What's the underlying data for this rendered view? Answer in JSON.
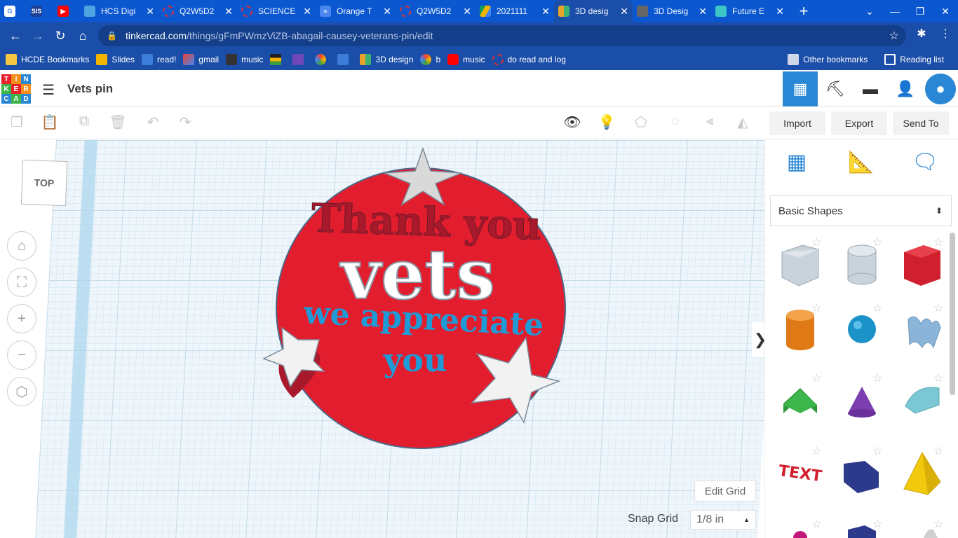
{
  "browser": {
    "tabs": [
      {
        "title": "",
        "icon": "google-icon",
        "color": "#ffffff"
      },
      {
        "title": "",
        "icon": "sis-icon",
        "color": "#1c3f94",
        "badge": "SIS"
      },
      {
        "title": "",
        "icon": "youtube-icon",
        "color": "#ff0000"
      },
      {
        "title": "HCS Digi",
        "icon": "hcs-icon",
        "color": "#4fa3e0"
      },
      {
        "title": "Q2W5D2",
        "icon": "red-ring-icon",
        "color": "#e03030"
      },
      {
        "title": "SCIENCE",
        "icon": "red-ring-icon",
        "color": "#e03030"
      },
      {
        "title": "Orange T",
        "icon": "docs-icon",
        "color": "#4a86f0"
      },
      {
        "title": "Q2W5D2",
        "icon": "red-ring-icon",
        "color": "#e03030"
      },
      {
        "title": "2021111",
        "icon": "drive-icon",
        "color": "#f4b400"
      },
      {
        "title": "3D desig",
        "icon": "tinkercad-icon",
        "color": "#e8a32a",
        "active": true
      },
      {
        "title": "3D Desig",
        "icon": "classroom-icon",
        "color": "#888888"
      },
      {
        "title": "Future E",
        "icon": "future-icon",
        "color": "#3dc6c6"
      }
    ],
    "url_host": "tinkercad.com",
    "url_path": "/things/gFmPWmzViZB-abagail-causey-veterans-pin/edit",
    "bookmarks": [
      {
        "label": "HCDE Bookmarks",
        "icon": "folder-icon",
        "color": "#f3c742"
      },
      {
        "label": "Slides",
        "icon": "slides-icon",
        "color": "#f4b400"
      },
      {
        "label": "read!",
        "icon": "read-icon",
        "color": "#3c7dd9"
      },
      {
        "label": "gmail",
        "icon": "gmail-icon",
        "color": "#ea4335"
      },
      {
        "label": "music",
        "icon": "music-icon",
        "color": "#333333"
      },
      {
        "label": "",
        "icon": "flag-icon",
        "color": "#222222"
      },
      {
        "label": "",
        "icon": "forms-icon",
        "color": "#7248b9"
      },
      {
        "label": "",
        "icon": "badge-icon",
        "color": "#3ca03c"
      },
      {
        "label": "",
        "icon": "mp-icon",
        "color": "#3c7dd9"
      },
      {
        "label": "3D design",
        "icon": "tinkercad-icon",
        "color": "#e8a32a"
      },
      {
        "label": "b",
        "icon": "badge-icon",
        "color": "#3ca03c"
      },
      {
        "label": "music",
        "icon": "youtube-icon",
        "color": "#ff0000"
      },
      {
        "label": "do read and log",
        "icon": "red-ring-icon",
        "color": "#e03030"
      }
    ],
    "other_bookmarks": "Other bookmarks",
    "reading_list": "Reading list"
  },
  "app": {
    "logo_letters": [
      "T",
      "I",
      "N",
      "K",
      "E",
      "R",
      "C",
      "A",
      "D"
    ],
    "design_title": "Vets pin",
    "toolbar_right": {
      "import": "Import",
      "export": "Export",
      "send_to": "Send To"
    }
  },
  "workplane": {
    "viewcube_label": "TOP",
    "edit_grid": "Edit Grid",
    "snap_grid_label": "Snap Grid",
    "snap_grid_value": "1/8 in",
    "model": {
      "line1": "Thank you",
      "line2": "vets",
      "line3": "we appreciate",
      "line4": "you"
    }
  },
  "panel": {
    "category": "Basic Shapes"
  },
  "colors": {
    "chrome_blue": "#1b4ea8",
    "tab_strip": "#0b57d0",
    "tinkercad_blue": "#2a87d5",
    "pin_red": "#e11d2e",
    "text_blue": "#1e9bd6"
  }
}
